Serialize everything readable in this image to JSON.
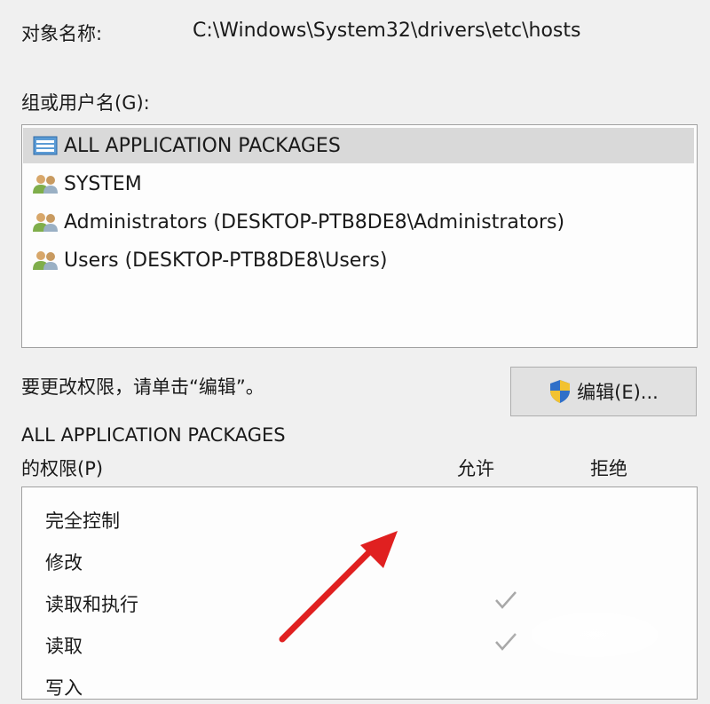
{
  "object": {
    "label": "对象名称:",
    "value": "C:\\Windows\\System32\\drivers\\etc\\hosts"
  },
  "groups": {
    "label": "组或用户名(G):",
    "items": [
      {
        "label": "ALL APPLICATION PACKAGES",
        "icon": "packages-icon",
        "selected": true
      },
      {
        "label": "SYSTEM",
        "icon": "users-icon",
        "selected": false
      },
      {
        "label": "Administrators (DESKTOP-PTB8DE8\\Administrators)",
        "icon": "users-icon",
        "selected": false
      },
      {
        "label": "Users (DESKTOP-PTB8DE8\\Users)",
        "icon": "users-icon",
        "selected": false
      }
    ]
  },
  "edit": {
    "hint": "要更改权限，请单击“编辑”。",
    "button_label": "编辑(E)...",
    "icon": "shield-icon"
  },
  "permissions": {
    "title_line1": "ALL APPLICATION PACKAGES",
    "title_line2": "的权限(P)",
    "col_allow": "允许",
    "col_deny": "拒绝",
    "rows": [
      {
        "label": "完全控制",
        "allow": false,
        "deny": false
      },
      {
        "label": "修改",
        "allow": false,
        "deny": false
      },
      {
        "label": "读取和执行",
        "allow": true,
        "deny": false
      },
      {
        "label": "读取",
        "allow": true,
        "deny": false
      },
      {
        "label": "写入",
        "allow": false,
        "deny": false
      }
    ]
  },
  "colors": {
    "selection": "#d9d9d9",
    "arrow": "#e02020",
    "check": "#a8a8a8"
  }
}
